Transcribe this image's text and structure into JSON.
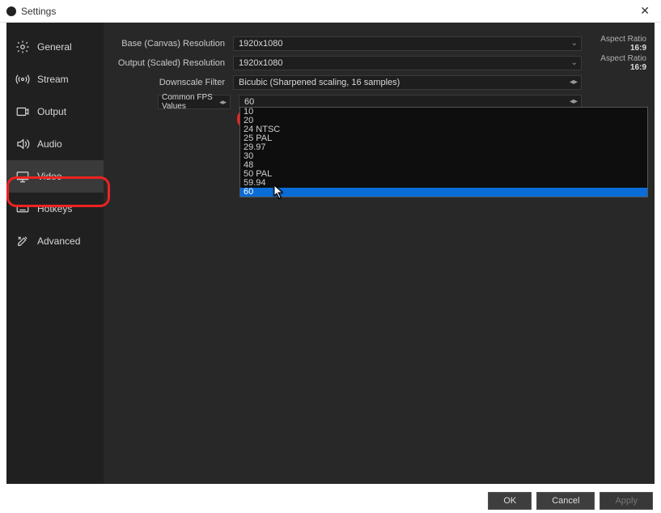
{
  "window": {
    "title": "Settings"
  },
  "sidebar": {
    "items": [
      {
        "label": "General"
      },
      {
        "label": "Stream"
      },
      {
        "label": "Output"
      },
      {
        "label": "Audio"
      },
      {
        "label": "Video"
      },
      {
        "label": "Hotkeys"
      },
      {
        "label": "Advanced"
      }
    ]
  },
  "video": {
    "base_label": "Base (Canvas) Resolution",
    "base_value": "1920x1080",
    "base_aspect_label": "Aspect Ratio",
    "base_aspect_value": "16:9",
    "output_label": "Output (Scaled) Resolution",
    "output_value": "1920x1080",
    "output_aspect_label": "Aspect Ratio",
    "output_aspect_value": "16:9",
    "filter_label": "Downscale Filter",
    "filter_value": "Bicubic (Sharpened scaling, 16 samples)",
    "fps_type_label": "Common FPS Values",
    "fps_value": "60",
    "fps_options": [
      "10",
      "20",
      "24 NTSC",
      "25 PAL",
      "29.97",
      "30",
      "48",
      "50 PAL",
      "59.94",
      "60"
    ]
  },
  "footer": {
    "ok": "OK",
    "cancel": "Cancel",
    "apply": "Apply"
  }
}
